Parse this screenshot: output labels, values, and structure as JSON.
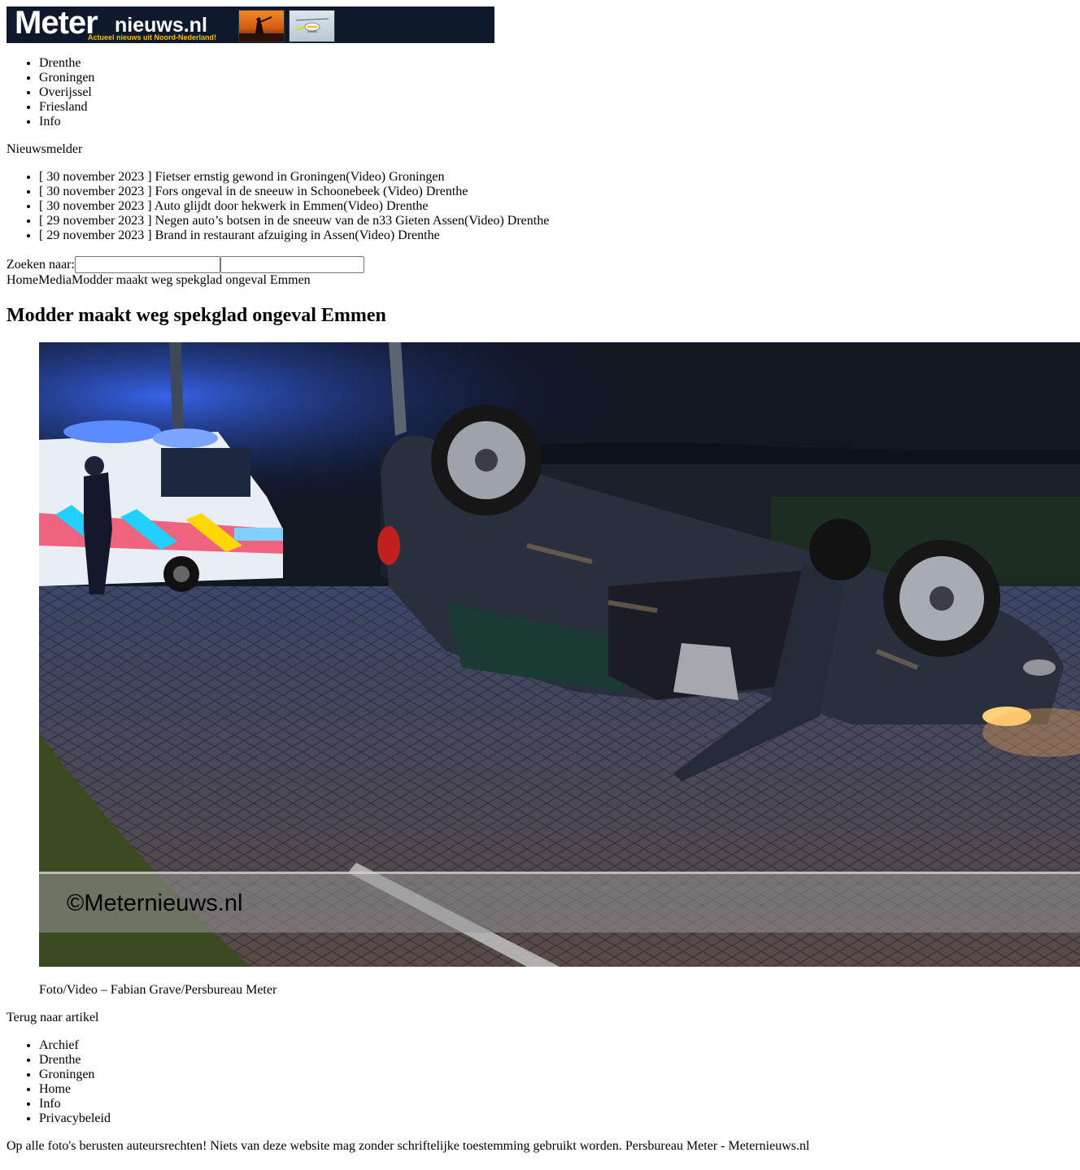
{
  "header": {
    "logo_text_main": "Meter",
    "logo_text_suffix": "nieuws.nl",
    "logo_tagline": "Actueel nieuws uit Noord-Nederland!"
  },
  "nav": {
    "items": [
      "Drenthe",
      "Groningen",
      "Overijssel",
      "Friesland",
      "Info"
    ]
  },
  "ticker": {
    "label": "Nieuwsmelder",
    "items": [
      {
        "date": "[ 30 november 2023 ]",
        "title": "Fietser ernstig gewond in Groningen(Video)",
        "category": "Groningen"
      },
      {
        "date": "[ 30 november 2023 ]",
        "title": "Fors ongeval in de sneeuw in Schoonebeek (Video)",
        "category": "Drenthe"
      },
      {
        "date": "[ 30 november 2023 ]",
        "title": "Auto glijdt door hekwerk in Emmen(Video)",
        "category": "Drenthe"
      },
      {
        "date": "[ 29 november 2023 ]",
        "title": "Negen auto’s botsen in de sneeuw van de n33 Gieten Assen(Video)",
        "category": "Drenthe"
      },
      {
        "date": "[ 29 november 2023 ]",
        "title": "Brand in restaurant afzuiging in Assen(Video)",
        "category": "Drenthe"
      }
    ]
  },
  "search": {
    "label": "Zoeken naar:",
    "value": "",
    "button_value": ""
  },
  "breadcrumb": {
    "home": "Home",
    "media": "Media",
    "current": "Modder maakt weg spekglad ongeval Emmen"
  },
  "article": {
    "title": "Modder maakt weg spekglad ongeval Emmen",
    "image_watermark": "©Meternieuws.nl",
    "caption": "Foto/Video – Fabian Grave/Persbureau Meter",
    "back_link": "Terug naar artikel"
  },
  "footer_menu": {
    "items": [
      "Archief",
      "Drenthe",
      "Groningen",
      "Home",
      "Info",
      "Privacybeleid"
    ]
  },
  "footer": {
    "copyright": "Op alle foto's berusten auteursrechten! Niets van deze website mag zonder schriftelijke toestemming gebruikt worden. Persbureau Meter - Meternieuws.nl"
  },
  "colors": {
    "banner_bg": "#0e1a2c",
    "logo_tagline": "#f3c200"
  }
}
